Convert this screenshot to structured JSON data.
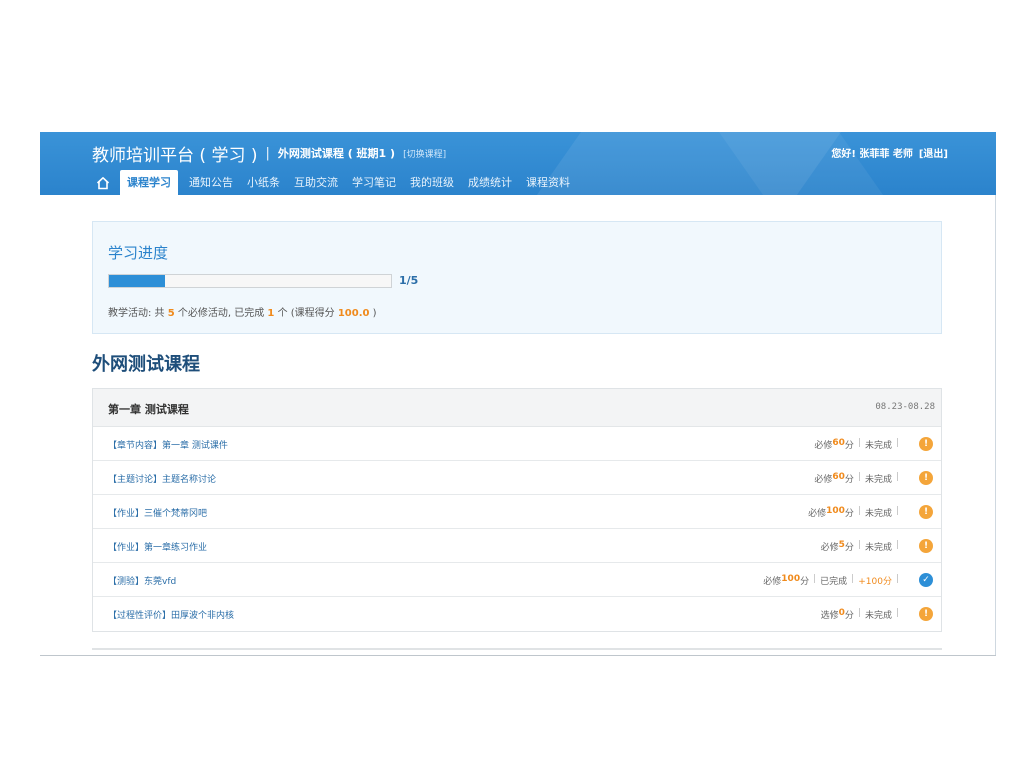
{
  "header": {
    "platform_title": "教师培训平台 ( 学习 )",
    "separator": "|",
    "course_name": "外网测试课程 ( 班期1 )",
    "switch_course": "[切换课程]",
    "greeting": "您好! 张菲菲 老师",
    "logout": "[退出]"
  },
  "nav": {
    "items": [
      {
        "label": "课程学习"
      },
      {
        "label": "通知公告"
      },
      {
        "label": "小纸条"
      },
      {
        "label": "互助交流"
      },
      {
        "label": "学习笔记"
      },
      {
        "label": "我的班级"
      },
      {
        "label": "成绩统计"
      },
      {
        "label": "课程资料"
      }
    ],
    "active": "课程学习"
  },
  "progress": {
    "title": "学习进度",
    "completed": 1,
    "total": 5,
    "fraction": 0.2,
    "count_text": "1/5",
    "desc_prefix": "教学活动: 共 ",
    "required_count": "5",
    "desc_mid1": " 个必修活动, 已完成 ",
    "done_count": "1",
    "desc_mid2": " 个 (课程得分 ",
    "score": "100.0",
    "desc_suffix": " )"
  },
  "course": {
    "title": "外网测试课程",
    "chapter": {
      "name": "第一章 测试课程",
      "date_range": "08.23-08.28"
    },
    "activities": [
      {
        "name": "【章节内容】第一章 测试课件",
        "req": "必修",
        "points": "60",
        "unit": "分",
        "status": "未完成",
        "bonus": "",
        "icon": "warn"
      },
      {
        "name": "【主题讨论】主题名称讨论",
        "req": "必修",
        "points": "60",
        "unit": "分",
        "status": "未完成",
        "bonus": "",
        "icon": "warn"
      },
      {
        "name": "【作业】三催个梵蒂冈吧",
        "req": "必修",
        "points": "100",
        "unit": "分",
        "status": "未完成",
        "bonus": "",
        "icon": "warn"
      },
      {
        "name": "【作业】第一章练习作业",
        "req": "必修",
        "points": "5",
        "unit": "分",
        "status": "未完成",
        "bonus": "",
        "icon": "warn"
      },
      {
        "name": "【测验】东莞vfd",
        "req": "必修",
        "points": "100",
        "unit": "分",
        "status": "已完成",
        "bonus": "+100分",
        "icon": "done"
      },
      {
        "name": "【过程性评价】田厚波个非内核",
        "req": "选修",
        "points": "0",
        "unit": "分",
        "status": "未完成",
        "bonus": "",
        "icon": "warn"
      }
    ]
  },
  "colors": {
    "header_blue": "#2b83cc",
    "accent_orange": "#f08a1c",
    "progress_fill": "#2d8fd7"
  }
}
